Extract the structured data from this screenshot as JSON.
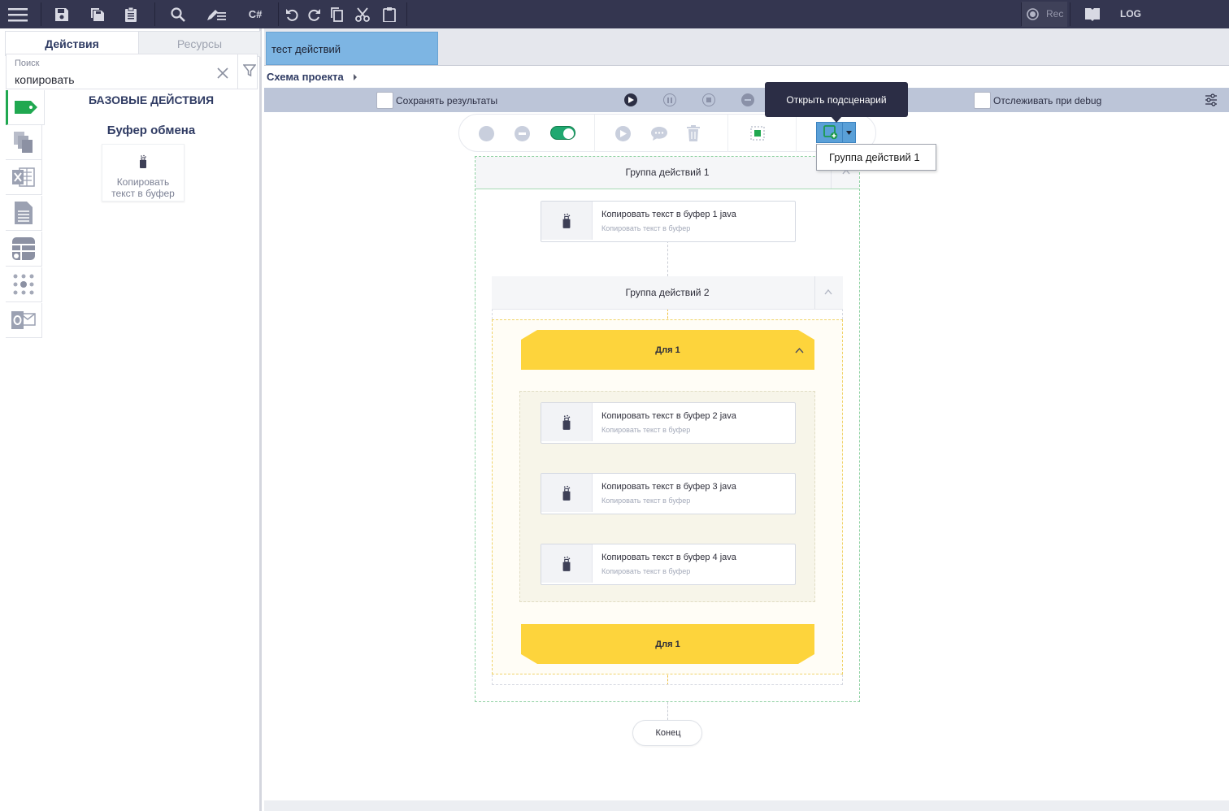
{
  "toolbar": {
    "rec_label": "Rec",
    "log_label": "LOG",
    "csharp_label": "C#"
  },
  "left_panel": {
    "tabs": [
      {
        "label": "Действия",
        "active": true
      },
      {
        "label": "Ресурсы",
        "active": false
      }
    ],
    "search": {
      "label": "Поиск",
      "value": "копировать"
    },
    "section_title": "БАЗОВЫЕ ДЕЙСТВИЯ",
    "group_title": "Буфер обмена",
    "action_tile": {
      "line1": "Копировать",
      "line2": "текст в буфер"
    },
    "rail_icons": [
      "tag-icon",
      "copy-files-icon",
      "excel-icon",
      "document-icon",
      "table-icon",
      "dots-grid-icon",
      "outlook-icon"
    ]
  },
  "document_tab": {
    "label": "тест действий"
  },
  "breadcrumb": {
    "label": "Схема проекта"
  },
  "control_bar": {
    "save_results_label": "Сохранять результаты",
    "save_results_checked": false,
    "track_debug_label": "Отслеживать при debug",
    "track_debug_checked": false
  },
  "tooltip": {
    "text": "Открыть подсценарий"
  },
  "dropdown": {
    "item": "Группа действий 1"
  },
  "flow": {
    "group1": {
      "title": "Группа действий  1"
    },
    "card1": {
      "title": "Копировать текст в буфер  1  java",
      "subtitle": "Копировать текст в буфер"
    },
    "group2": {
      "title": "Группа действий  2"
    },
    "loop_start": {
      "label": "Для  1"
    },
    "card2": {
      "title": "Копировать текст в буфер  2  java",
      "subtitle": "Копировать текст в буфер"
    },
    "card3": {
      "title": "Копировать текст в буфер  3  java",
      "subtitle": "Копировать текст в буфер"
    },
    "card4": {
      "title": "Копировать текст в буфер  4  java",
      "subtitle": "Копировать текст в буфер"
    },
    "loop_end": {
      "label": "Для  1"
    },
    "end": {
      "label": "Конец"
    }
  },
  "colors": {
    "topbar": "#343650",
    "ctrlbar": "#bcc5d8",
    "doc_tab": "#7db5e3",
    "loop_yellow": "#fdd43c",
    "active_tag": "#20a850",
    "tooltip_bg": "#2b2d45"
  }
}
